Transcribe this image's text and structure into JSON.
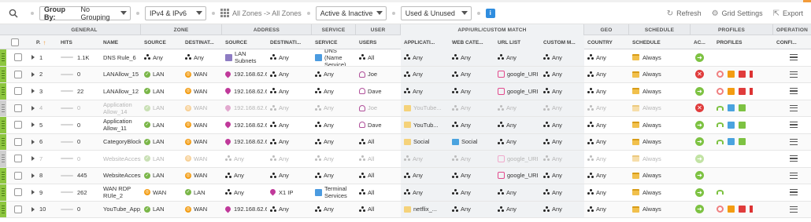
{
  "toolbar": {
    "group_by_label": "Group By:",
    "group_by_value": "No Grouping",
    "ip_version": "IPv4 & IPv6",
    "zones": "All Zones -> All Zones",
    "state": "Active & Inactive",
    "usage": "Used & Unused",
    "info": "i",
    "refresh": "Refresh",
    "grid_settings": "Grid Settings",
    "export": "Export"
  },
  "groups": {
    "general": "GENERAL",
    "zone": "ZONE",
    "address": "ADDRESS",
    "service": "SERVICE",
    "user": "USER",
    "app": "APP/URL/CUSTOM MATCH",
    "geo": "GEO",
    "schedule": "SCHEDULE",
    "profiles": "PROFILES",
    "operation": "OPERATION"
  },
  "columns": {
    "priority": "P.",
    "hits": "HITS",
    "name": "NAME",
    "zone_source": "SOURCE",
    "zone_dest": "DESTINAT...",
    "addr_source": "SOURCE",
    "addr_dest": "DESTINATI...",
    "service": "SERVICE",
    "users": "USERS",
    "application": "APPLICATI...",
    "web_category": "WEB CATE...",
    "url_list": "URL LIST",
    "custom_match": "CUSTOM M...",
    "country": "COUNTRY",
    "schedule": "SCHEDULE",
    "action": "AC...",
    "profiles": "PROFILES",
    "config": "CONFI..."
  },
  "rows": [
    {
      "priority": "1",
      "hits": "1.1K",
      "name": "DNS Rule_6",
      "zsrc": "Any",
      "zsrc_t": "any",
      "zdst": "Any",
      "zdst_t": "any",
      "asrc": "LAN Subnets",
      "asrc_t": "lan",
      "adst": "Any",
      "adst_t": "any",
      "svc": "DNS (Name Service)",
      "svc_t": "svc",
      "users": "All",
      "users_t": "any",
      "app": "Any",
      "app_t": "any",
      "web": "Any",
      "web_t": "any",
      "url": "Any",
      "url_t": "any",
      "custom": "Any",
      "country": "Any",
      "schedule": "Always",
      "action": "allow",
      "profiles": [],
      "dim": false
    },
    {
      "priority": "2",
      "hits": "0",
      "name": "LANAllow_15",
      "zsrc": "LAN",
      "zsrc_t": "lan",
      "zdst": "WAN",
      "zdst_t": "wan",
      "asrc": "192.168.62.62",
      "asrc_t": "pin",
      "adst": "Any",
      "adst_t": "any",
      "svc": "Any",
      "svc_t": "any",
      "users": "Joe",
      "users_t": "user",
      "app": "Any",
      "app_t": "any",
      "web": "Any",
      "web_t": "any",
      "url": "google_URI",
      "url_t": "url",
      "custom": "Any",
      "country": "Any",
      "schedule": "Always",
      "action": "deny",
      "profiles": [
        "p1",
        "p2",
        "p3",
        "p4"
      ],
      "dim": false
    },
    {
      "priority": "3",
      "hits": "22",
      "name": "LANAllow_12",
      "zsrc": "LAN",
      "zsrc_t": "lan",
      "zdst": "WAN",
      "zdst_t": "wan",
      "asrc": "192.168.62.62",
      "asrc_t": "pin",
      "adst": "Any",
      "adst_t": "any",
      "svc": "Any",
      "svc_t": "any",
      "users": "Dave",
      "users_t": "user",
      "app": "Any",
      "app_t": "any",
      "web": "Any",
      "web_t": "any",
      "url": "google_URI",
      "url_t": "url",
      "custom": "Any",
      "country": "Any",
      "schedule": "Always",
      "action": "allow",
      "profiles": [
        "p1",
        "p2",
        "p3",
        "p4"
      ],
      "dim": false
    },
    {
      "priority": "4",
      "hits": "0",
      "name": "Application Allow_14",
      "zsrc": "LAN",
      "zsrc_t": "lan",
      "zdst": "WAN",
      "zdst_t": "wan",
      "asrc": "192.168.62.62",
      "asrc_t": "pin",
      "adst": "Any",
      "adst_t": "any",
      "svc": "Any",
      "svc_t": "any",
      "users": "Joe",
      "users_t": "user",
      "app": "YouTube...",
      "app_t": "app",
      "web": "Any",
      "web_t": "any",
      "url": "Any",
      "url_t": "any",
      "custom": "Any",
      "country": "Any",
      "schedule": "Always",
      "action": "deny",
      "profiles": [
        "p5",
        "p6",
        "p7"
      ],
      "dim": true
    },
    {
      "priority": "5",
      "hits": "0",
      "name": "Application Allow_11",
      "zsrc": "LAN",
      "zsrc_t": "lan",
      "zdst": "WAN",
      "zdst_t": "wan",
      "asrc": "192.168.62.62",
      "asrc_t": "pin",
      "adst": "Any",
      "adst_t": "any",
      "svc": "Any",
      "svc_t": "any",
      "users": "Dave",
      "users_t": "user",
      "app": "YouTub...",
      "app_t": "app",
      "web": "Any",
      "web_t": "any",
      "url": "Any",
      "url_t": "any",
      "custom": "Any",
      "country": "Any",
      "schedule": "Always",
      "action": "allow",
      "profiles": [
        "p5",
        "p6",
        "p7"
      ],
      "dim": false
    },
    {
      "priority": "6",
      "hits": "0",
      "name": "CategoryBlock_10",
      "zsrc": "LAN",
      "zsrc_t": "lan",
      "zdst": "WAN",
      "zdst_t": "wan",
      "asrc": "192.168.62.62",
      "asrc_t": "pin",
      "adst": "Any",
      "adst_t": "any",
      "svc": "Any",
      "svc_t": "any",
      "users": "All",
      "users_t": "any",
      "app": "Social",
      "app_t": "app",
      "web": "Social",
      "web_t": "web",
      "url": "Any",
      "url_t": "any",
      "custom": "Any",
      "country": "Any",
      "schedule": "Always",
      "action": "allow",
      "profiles": [
        "p5",
        "p6",
        "p7"
      ],
      "dim": false
    },
    {
      "priority": "7",
      "hits": "0",
      "name": "WebsiteAccess_13",
      "zsrc": "LAN",
      "zsrc_t": "lan",
      "zdst": "WAN",
      "zdst_t": "wan",
      "asrc": "Any",
      "asrc_t": "any",
      "adst": "Any",
      "adst_t": "any",
      "svc": "Any",
      "svc_t": "any",
      "users": "All",
      "users_t": "any",
      "app": "Any",
      "app_t": "any",
      "web": "Any",
      "web_t": "any",
      "url": "google_URI",
      "url_t": "url",
      "custom": "Any",
      "country": "Any",
      "schedule": "Always",
      "action": "allow",
      "profiles": [],
      "dim": true
    },
    {
      "priority": "8",
      "hits": "445",
      "name": "WebsiteAccess_1",
      "zsrc": "LAN",
      "zsrc_t": "lan",
      "zdst": "WAN",
      "zdst_t": "wan",
      "asrc": "Any",
      "asrc_t": "any",
      "adst": "Any",
      "adst_t": "any",
      "svc": "Any",
      "svc_t": "any",
      "users": "All",
      "users_t": "any",
      "app": "Any",
      "app_t": "any",
      "web": "Any",
      "web_t": "any",
      "url": "google_URI",
      "url_t": "url",
      "custom": "Any",
      "country": "Any",
      "schedule": "Always",
      "action": "allow",
      "profiles": [],
      "dim": false
    },
    {
      "priority": "9",
      "hits": "262",
      "name": "WAN RDP RUle_2",
      "zsrc": "WAN",
      "zsrc_t": "wan",
      "zdst": "LAN",
      "zdst_t": "lan",
      "asrc": "Any",
      "asrc_t": "any",
      "adst": "X1 IP",
      "adst_t": "pin",
      "svc": "Terminal Services",
      "svc_t": "svc",
      "users": "All",
      "users_t": "any",
      "app": "Any",
      "app_t": "any",
      "web": "Any",
      "web_t": "any",
      "url": "Any",
      "url_t": "any",
      "custom": "Any",
      "country": "Any",
      "schedule": "Always",
      "action": "allow",
      "profiles": [
        "p5"
      ],
      "dim": false
    },
    {
      "priority": "10",
      "hits": "0",
      "name": "YouTube_App_3",
      "zsrc": "LAN",
      "zsrc_t": "lan",
      "zdst": "WAN",
      "zdst_t": "wan",
      "asrc": "192.168.62.62",
      "asrc_t": "pin",
      "adst": "Any",
      "adst_t": "any",
      "svc": "Any",
      "svc_t": "any",
      "users": "All",
      "users_t": "any",
      "app": "netflix_...",
      "app_t": "app",
      "web": "Any",
      "web_t": "any",
      "url": "Any",
      "url_t": "any",
      "custom": "Any",
      "country": "Any",
      "schedule": "Always",
      "action": "allow",
      "profiles": [
        "p1",
        "p2",
        "p3",
        "p4"
      ],
      "dim": false
    }
  ]
}
